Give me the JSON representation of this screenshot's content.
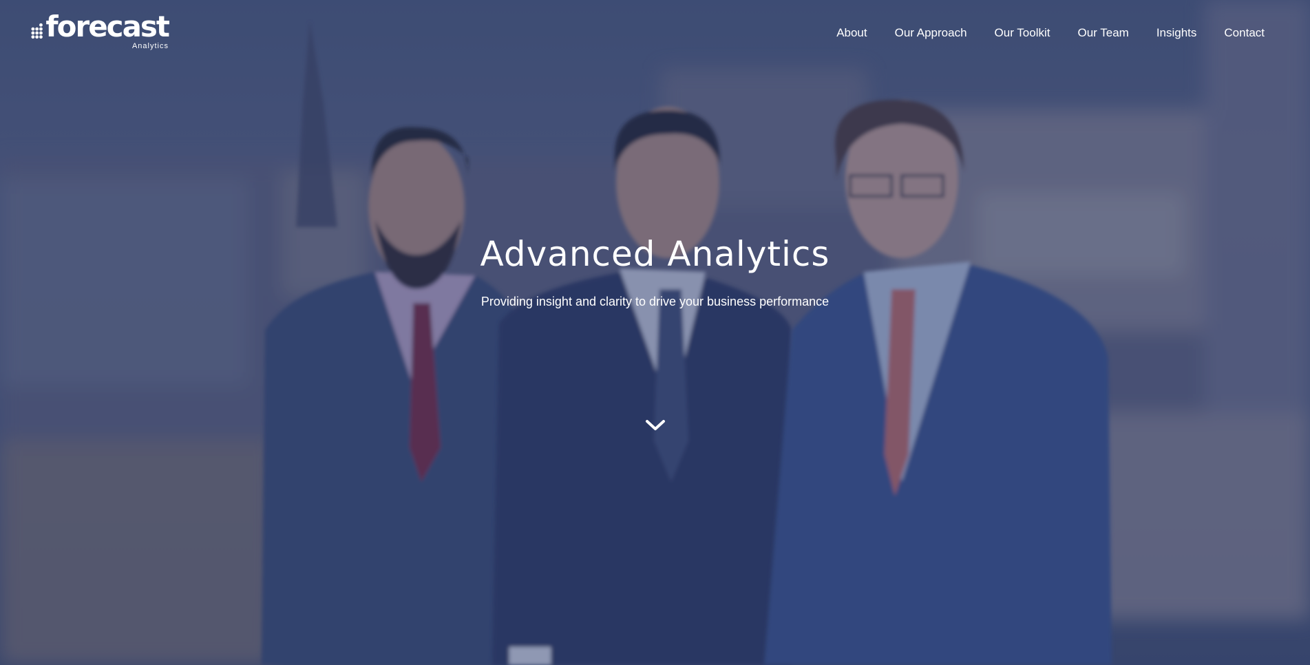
{
  "brand": {
    "name": "forecast",
    "subtitle": "Analytics",
    "logo_icon": "dot-grid-logo-icon"
  },
  "nav": {
    "items": [
      {
        "label": "About"
      },
      {
        "label": "Our Approach"
      },
      {
        "label": "Our Toolkit"
      },
      {
        "label": "Our Team"
      },
      {
        "label": "Insights"
      },
      {
        "label": "Contact"
      }
    ]
  },
  "hero": {
    "title": "Advanced Analytics",
    "subtitle": "Providing insight and clarity to drive your business performance",
    "scroll_icon": "chevron-down-icon"
  },
  "colors": {
    "overlay": "#2e3f6e",
    "text": "#ffffff"
  }
}
